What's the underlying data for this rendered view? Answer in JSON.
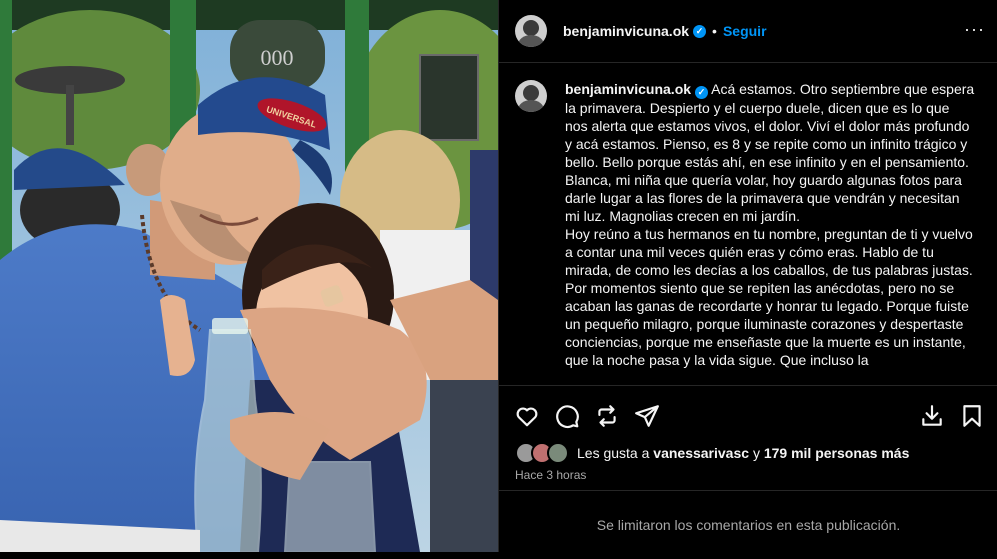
{
  "header": {
    "username": "benjaminvicuna.ok",
    "separator": "•",
    "follow_label": "Seguir",
    "more_icon": "more-horizontal-icon"
  },
  "caption": {
    "username": "benjaminvicuna.ok",
    "paragraphs": [
      "Acá estamos. Otro septiembre que espera la primavera. Despierto y el cuerpo duele, dicen que es lo que nos alerta que estamos vivos, el dolor. Viví el dolor más profundo y acá estamos. Pienso, es 8 y se repite como un infinito trágico y bello. Bello porque estás ahí, en ese infinito y en el pensamiento.",
      "Blanca, mi niña que quería volar, hoy guardo algunas fotos para darle lugar a las flores de la primavera que vendrán y necesitan mi luz. Magnolias crecen en mi jardín.",
      "Hoy reúno a tus hermanos en tu nombre, preguntan de ti y vuelvo a contar una mil veces quién eras y cómo eras. Hablo de tu mirada, de como les decías a los caballos, de tus palabras justas. Por momentos siento que se repiten las anécdotas, pero no se acaban las ganas de recordarte y honrar tu legado. Porque fuiste un pequeño milagro, porque iluminaste corazones y despertaste conciencias, porque me enseñaste que la muerte es un instante, que la noche pasa y la vida sigue. Que incluso la"
    ]
  },
  "photo": {
    "cap_text": "UNIVERSAL",
    "sign_text": "000"
  },
  "actions": {
    "icons": [
      "heart-icon",
      "comment-icon",
      "repost-icon",
      "share-icon",
      "save-download-icon",
      "bookmark-icon"
    ]
  },
  "likes": {
    "prefix": "Les gusta a",
    "user": "vanessarivasc",
    "middle": "y",
    "count": "179 mil personas más"
  },
  "time_ago": "Hace 3 horas",
  "comments_limited": "Se limitaron los comentarios en esta publicación."
}
